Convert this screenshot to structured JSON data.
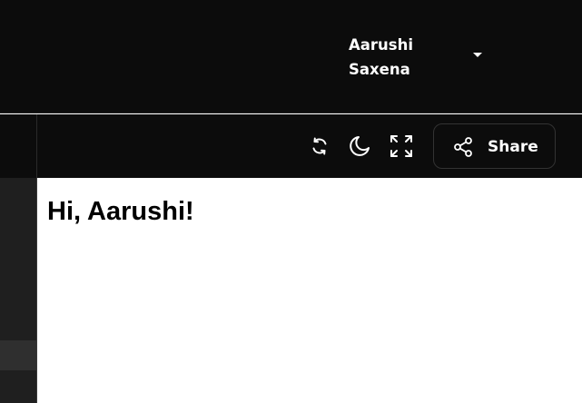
{
  "header": {
    "user_name": "Aarushi Saxena"
  },
  "toolbar": {
    "icons": [
      "refresh-icon",
      "moon-icon",
      "expand-icon"
    ],
    "share_label": "Share"
  },
  "main": {
    "greeting": "Hi, Aarushi!"
  },
  "colors": {
    "header_bg": "#0c0c0c",
    "sidebar_bg": "#1f1f1f",
    "content_bg": "#ffffff",
    "text_light": "#ffffff"
  }
}
